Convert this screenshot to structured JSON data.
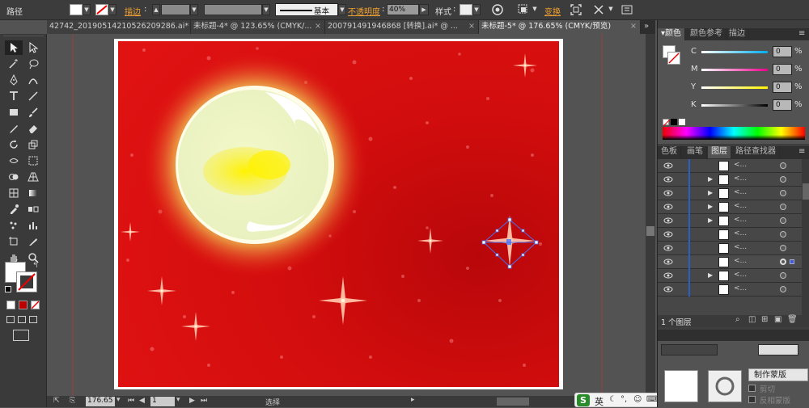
{
  "control_bar": {
    "object_type": "路径",
    "stroke_label": "描边",
    "basic_label": "基本",
    "opacity_label": "不透明度",
    "opacity_value": "40%",
    "style_label": "样式",
    "transform_label": "变换"
  },
  "doc_tabs": [
    {
      "label": "42742_20190514210526209286.ai*"
    },
    {
      "label": "未标题-4* @ 123.65% (CMYK/..."
    },
    {
      "label": "200791491946868 [转换].ai* @ ..."
    },
    {
      "label": "未标题-5* @ 176.65% (CMYK/预览)"
    }
  ],
  "color_panel": {
    "tabs": [
      "颜色",
      "颜色参考",
      "描边"
    ],
    "channels": [
      {
        "name": "C",
        "value": "0",
        "unit": "%"
      },
      {
        "name": "M",
        "value": "0",
        "unit": "%"
      },
      {
        "name": "Y",
        "value": "0",
        "unit": "%"
      },
      {
        "name": "K",
        "value": "0",
        "unit": "%"
      }
    ]
  },
  "layers_panel": {
    "tabs": [
      "色板",
      "画笔",
      "图层",
      "路径查找器"
    ],
    "rows": [
      {
        "name": "<...",
        "expandable": false
      },
      {
        "name": "<...",
        "expandable": true
      },
      {
        "name": "<...",
        "expandable": true
      },
      {
        "name": "<...",
        "expandable": true
      },
      {
        "name": "<...",
        "expandable": true
      },
      {
        "name": "<...",
        "expandable": false
      },
      {
        "name": "<...",
        "expandable": false
      },
      {
        "name": "<...",
        "expandable": false,
        "selected": true
      },
      {
        "name": "<...",
        "expandable": true
      },
      {
        "name": "<...",
        "expandable": false
      }
    ],
    "footer_count": "1 个图层"
  },
  "bottom_panel": {
    "make_mask": "制作蒙版",
    "clip": "剪切",
    "invert_mask": "反相蒙版"
  },
  "status_bar": {
    "zoom": "176.65",
    "page": "1",
    "mode": "选择"
  },
  "ime_bar": {
    "lang": "英"
  },
  "colors": {
    "canvas_red": "#d40f0f",
    "moon_glow": "#f3f8c8",
    "ui_bg": "#535353",
    "panel_bg": "#3e3e3e",
    "selection_blue": "#4a6ef0"
  }
}
